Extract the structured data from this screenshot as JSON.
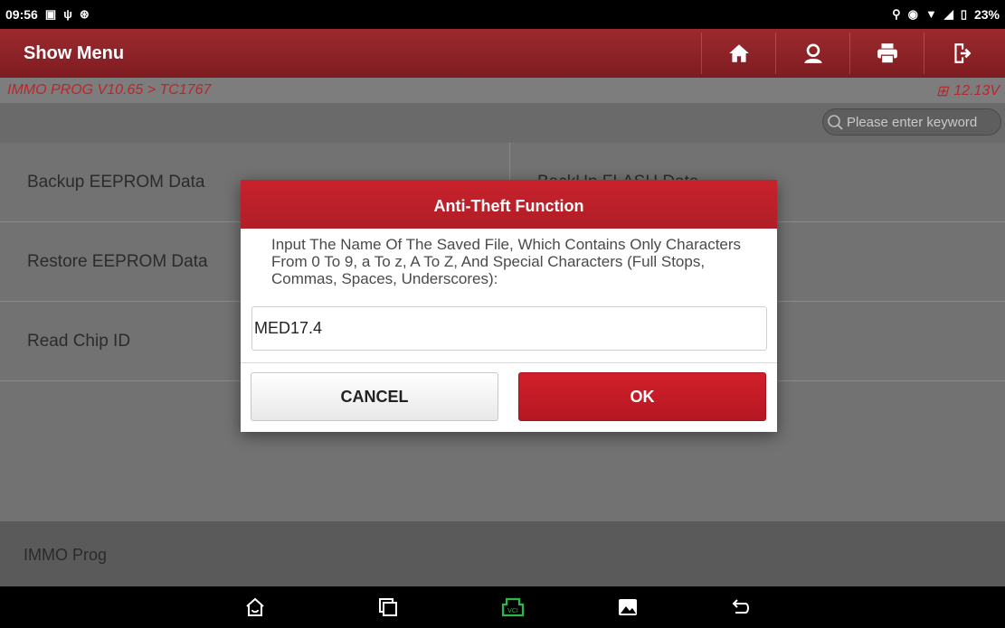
{
  "statusbar": {
    "time": "09:56",
    "battery": "23%",
    "left_icons": [
      "image-notification-icon",
      "usb-icon",
      "accessibility-icon"
    ],
    "right_icons": [
      "location-icon",
      "vibrate-icon",
      "wifi-icon",
      "signal-icon",
      "battery-icon"
    ]
  },
  "appbar": {
    "title": "Show Menu",
    "buttons": [
      "home-icon",
      "user-icon",
      "print-icon",
      "exit-icon"
    ]
  },
  "breadcrumb": {
    "path": "IMMO PROG V10.65 > TC1767",
    "voltage": "12.13V"
  },
  "search": {
    "placeholder": "Please enter keyword"
  },
  "menu": {
    "left_items": [
      "Backup EEPROM Data",
      "Restore EEPROM Data",
      "Read Chip ID"
    ],
    "right_items": [
      "BackUp FLASH Data",
      "",
      ""
    ]
  },
  "footer": {
    "label": "IMMO Prog"
  },
  "dialog": {
    "title": "Anti-Theft Function",
    "message": "Input The Name Of The Saved File, Which Contains Only Characters From 0 To 9, a To z, A To Z, And Special Characters (Full Stops, Commas, Spaces, Underscores):",
    "input_value": "MED17.4",
    "cancel_label": "CANCEL",
    "ok_label": "OK"
  },
  "navbar": {
    "buttons": [
      "home-nav-icon",
      "recents-icon",
      "vci-icon",
      "gallery-icon",
      "back-icon"
    ],
    "vci_color": "#2db84b"
  },
  "colors": {
    "accent_red": "#b01e27",
    "appbar_red": "#8b2227",
    "breadcrumb_text": "#b9262c"
  }
}
